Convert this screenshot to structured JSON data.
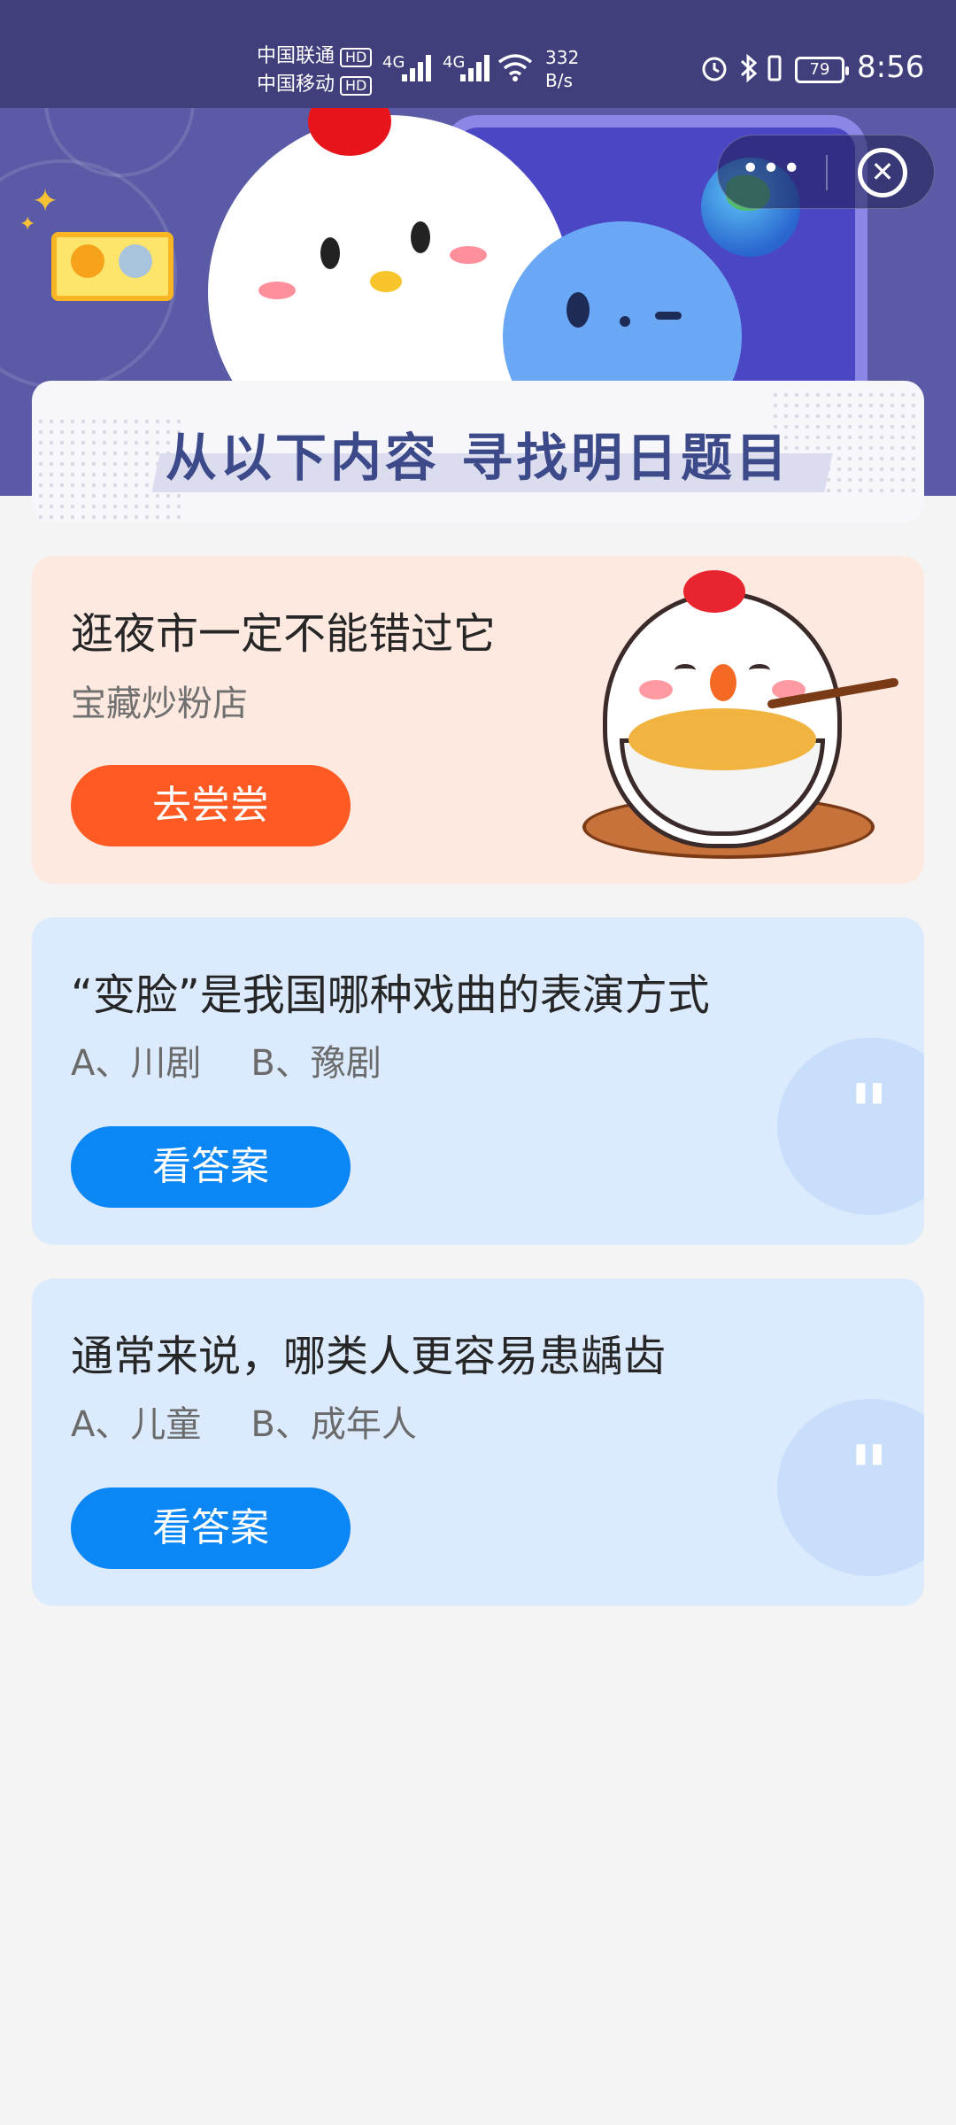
{
  "status_bar": {
    "carrier1": "中国联通",
    "carrier2": "中国移动",
    "hd": "HD",
    "network": "4G",
    "net_speed_value": "332",
    "net_speed_unit": "B/s",
    "battery": "79",
    "time": "8:56"
  },
  "capsule": {
    "more_icon": "more-dots-icon",
    "close_icon": "close-circle-icon"
  },
  "banner": {
    "title": "从以下内容  寻找明日题目"
  },
  "cards": [
    {
      "title": "逛夜市一定不能错过它",
      "subtitle": "宝藏炒粉店",
      "button": "去尝尝"
    },
    {
      "title": "“变脸”是我国哪种戏曲的表演方式",
      "options": [
        "A、川剧",
        "B、豫剧"
      ],
      "button": "看答案"
    },
    {
      "title": "通常来说，哪类人更容易患龋齿",
      "options": [
        "A、儿童",
        "B、成年人"
      ],
      "button": "看答案"
    }
  ],
  "colors": {
    "header_bg": "#5a5aa6",
    "status_bg": "#413f7b",
    "promo_card_bg": "#fde9e0",
    "question_card_bg": "#dbeafd",
    "orange_button": "#ff5a23",
    "blue_button": "#0a86f5",
    "title_text": "#3d4a8a"
  }
}
